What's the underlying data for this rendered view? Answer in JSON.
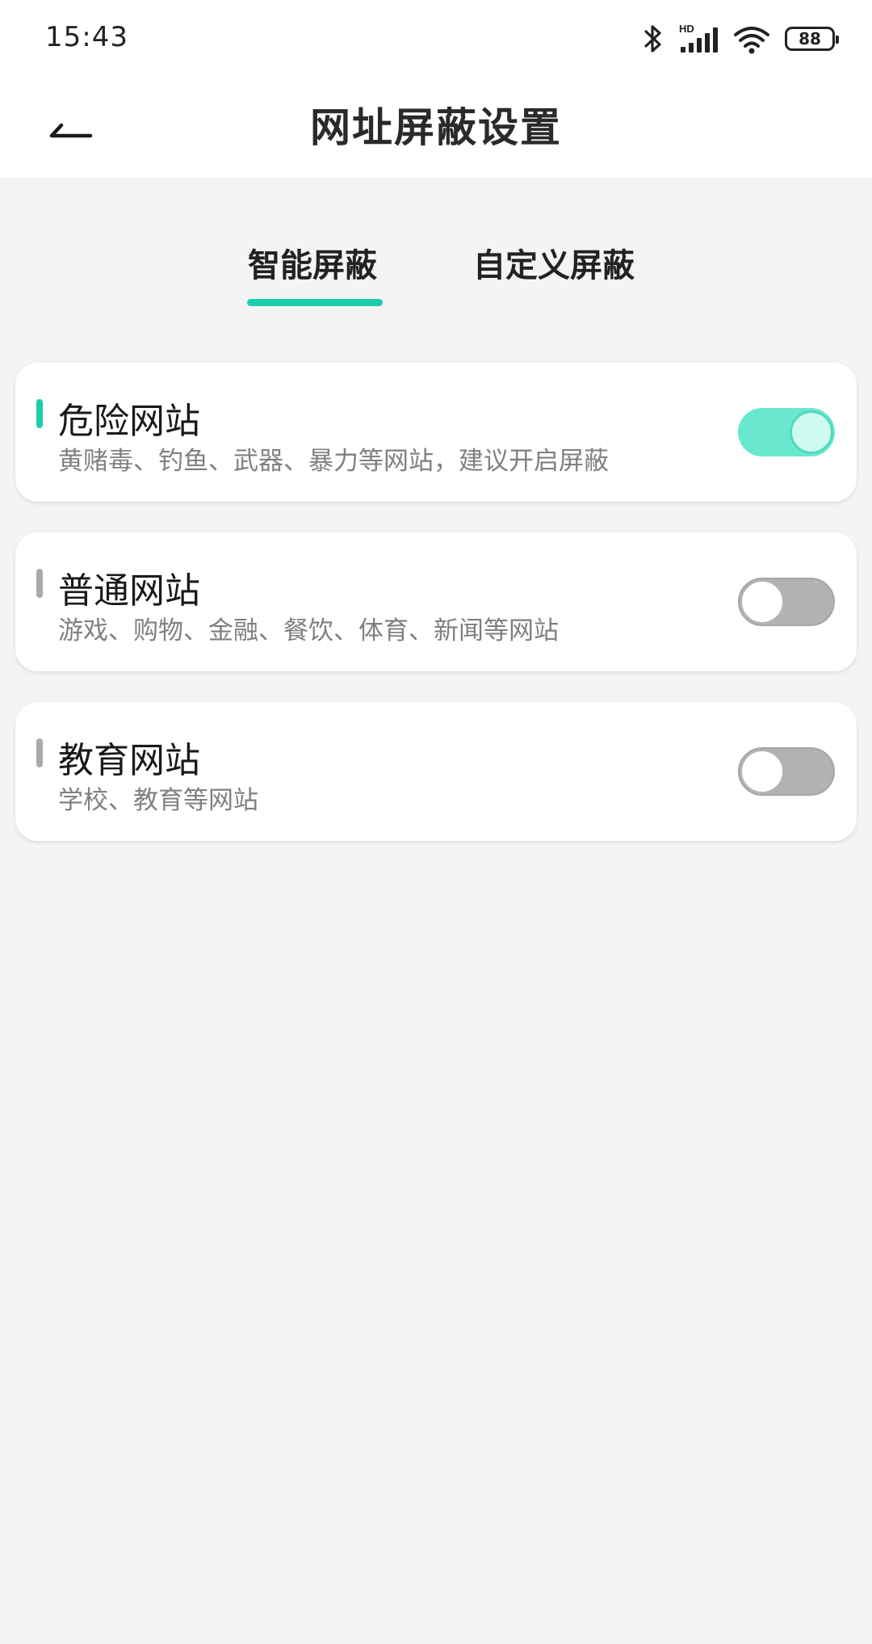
{
  "status_bar": {
    "time": "15:43",
    "hd_label": "HD",
    "battery_level": "88",
    "icons": [
      "bluetooth-icon",
      "hd-cellular-signal-icon",
      "wifi-icon",
      "battery-icon"
    ]
  },
  "header": {
    "back_icon": "back-arrow-icon",
    "title": "网址屏蔽设置"
  },
  "tabs": [
    {
      "label": "智能屏蔽",
      "active": true
    },
    {
      "label": "自定义屏蔽",
      "active": false
    }
  ],
  "items": [
    {
      "title": "危险网站",
      "description": "黄赌毒、钓鱼、武器、暴力等网站，建议开启屏蔽",
      "enabled": true
    },
    {
      "title": "普通网站",
      "description": "游戏、购物、金融、餐饮、体育、新闻等网站",
      "enabled": false
    },
    {
      "title": "教育网站",
      "description": "学校、教育等网站",
      "enabled": false
    }
  ],
  "colors": {
    "accent": "#1ccdaa",
    "toggle_on": "#6ae8cf",
    "toggle_off": "#b2b2b2",
    "background": "#f4f4f4",
    "card": "#ffffff"
  }
}
